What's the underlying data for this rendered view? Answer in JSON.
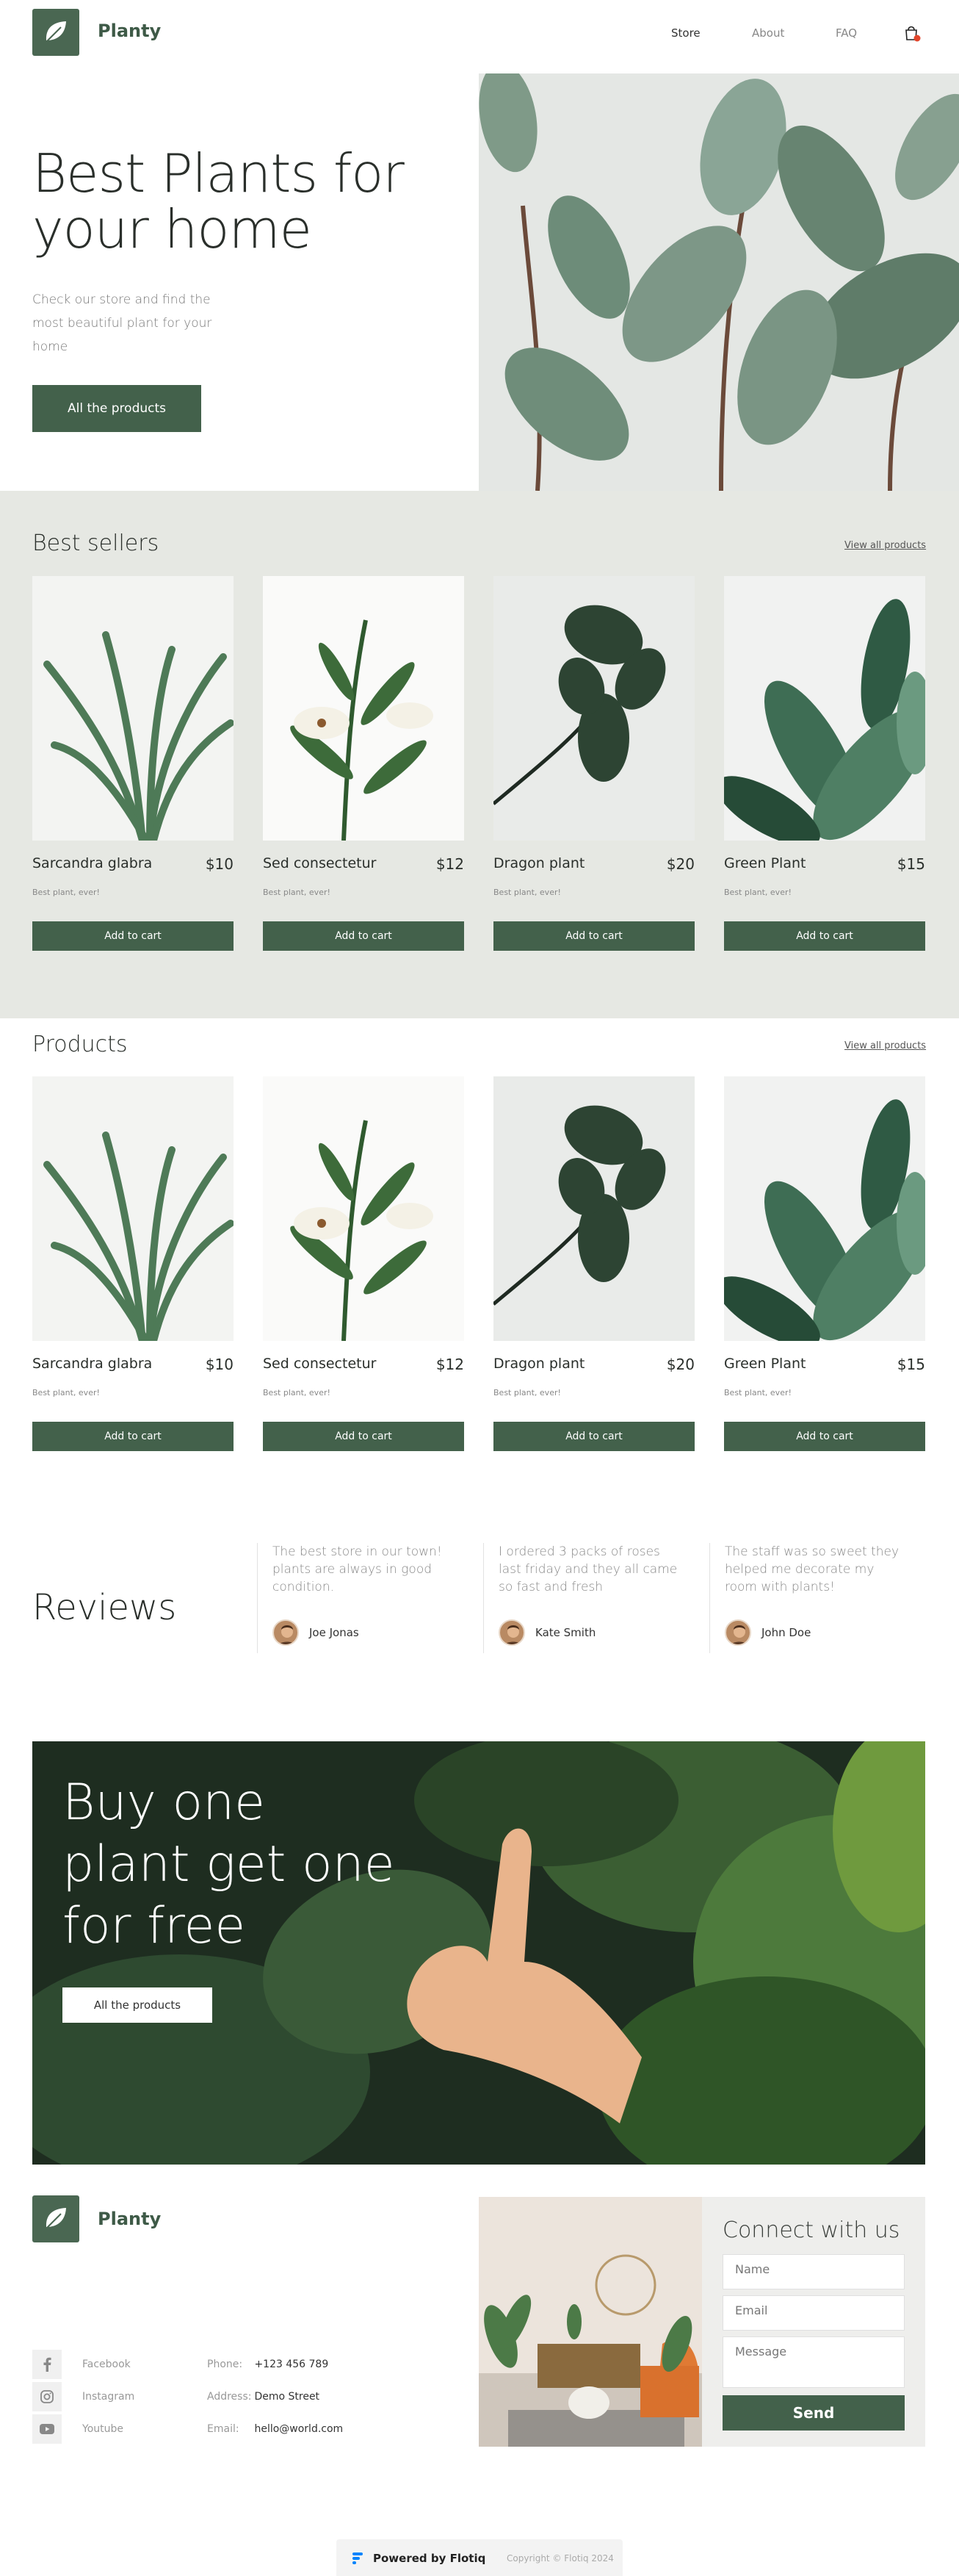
{
  "header": {
    "logo": "Planty",
    "nav": [
      "Store",
      "About",
      "FAQ"
    ]
  },
  "hero": {
    "title": "Best Plants for your home",
    "description": "Check our store and find the most beautiful plant for your home",
    "button": "All the products"
  },
  "best_sellers": {
    "title": "Best sellers",
    "view_all": "View all products",
    "products": [
      {
        "name": "Sarcandra glabra",
        "price": "$10",
        "sub": "Best plant, ever!",
        "button": "Add to cart"
      },
      {
        "name": "Sed consectetur",
        "price": "$12",
        "sub": "Best plant, ever!",
        "button": "Add to cart"
      },
      {
        "name": "Dragon plant",
        "price": "$20",
        "sub": "Best plant, ever!",
        "button": "Add to cart"
      },
      {
        "name": "Green Plant",
        "price": "$15",
        "sub": "Best plant, ever!",
        "button": "Add to cart"
      }
    ]
  },
  "products": {
    "title": "Products",
    "view_all": "View all products",
    "products": [
      {
        "name": "Sarcandra glabra",
        "price": "$10",
        "sub": "Best plant, ever!",
        "button": "Add to cart"
      },
      {
        "name": "Sed consectetur",
        "price": "$12",
        "sub": "Best plant, ever!",
        "button": "Add to cart"
      },
      {
        "name": "Dragon plant",
        "price": "$20",
        "sub": "Best plant, ever!",
        "button": "Add to cart"
      },
      {
        "name": "Green Plant",
        "price": "$15",
        "sub": "Best plant, ever!",
        "button": "Add to cart"
      }
    ]
  },
  "reviews": {
    "title": "Reviews",
    "items": [
      {
        "text": "The best store in our town! plants are always in good condition.",
        "author": "Joe Jonas"
      },
      {
        "text": "I ordered 3 packs of roses last friday and they all came so fast and fresh",
        "author": "Kate Smith"
      },
      {
        "text": "The staff was so sweet they helped me decorate my room with plants!",
        "author": "John Doe"
      }
    ]
  },
  "promo": {
    "title": "Buy one plant get one for free",
    "button": "All the products"
  },
  "footer": {
    "logo": "Planty",
    "social": [
      {
        "label": "Facebook",
        "icon": "facebook-icon"
      },
      {
        "label": "Instagram",
        "icon": "instagram-icon"
      },
      {
        "label": "Youtube",
        "icon": "youtube-icon"
      }
    ],
    "contact": [
      {
        "key": "Phone:",
        "value": "+123 456 789"
      },
      {
        "key": "Address:",
        "value": "Demo Street"
      },
      {
        "key": "Email:",
        "value": "hello@world.com"
      }
    ],
    "connect": {
      "title": "Connect with us",
      "name_placeholder": "Name",
      "email_placeholder": "Email",
      "message_placeholder": "Message",
      "send": "Send"
    }
  },
  "bottom_bar": {
    "powered": "Powered by Flotiq",
    "copyright": "Copyright © Flotiq 2024"
  },
  "colors": {
    "accent": "#43614b",
    "band": "#e6e8e3"
  }
}
